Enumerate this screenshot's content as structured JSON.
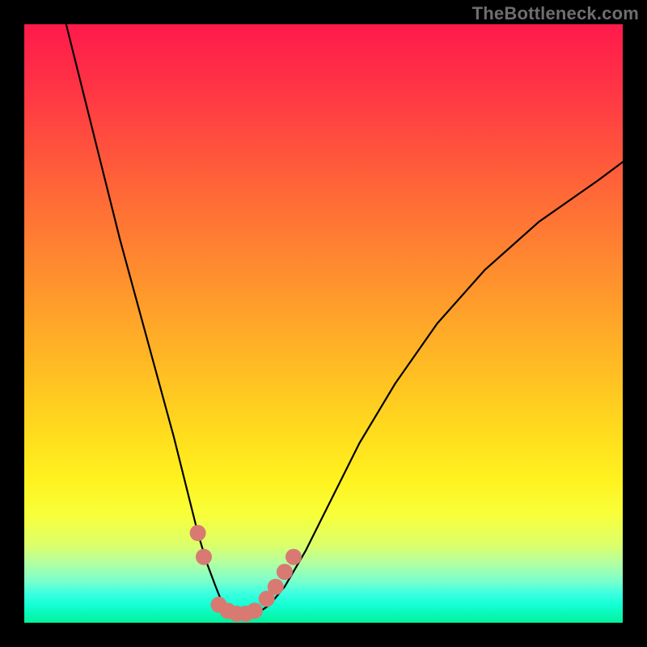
{
  "watermark": "TheBottleneck.com",
  "chart_data": {
    "type": "line",
    "title": "",
    "xlabel": "",
    "ylabel": "",
    "xlim": [
      0,
      100
    ],
    "ylim": [
      0,
      100
    ],
    "grid": false,
    "legend": false,
    "series": [
      {
        "name": "bottleneck-curve",
        "color": "#000000",
        "x": [
          7,
          10,
          13,
          16,
          19,
          22,
          25,
          27,
          29,
          30.5,
          32,
          33,
          34,
          35,
          36,
          37.5,
          39,
          41,
          43.5,
          47,
          51,
          56,
          62,
          69,
          77,
          86,
          96,
          100
        ],
        "y": [
          100,
          88,
          76,
          64,
          53,
          42,
          31,
          23,
          15,
          10,
          6,
          3.5,
          2,
          1.3,
          1,
          1.1,
          1.6,
          3,
          6,
          12,
          20,
          30,
          40,
          50,
          59,
          67,
          74,
          77
        ]
      }
    ],
    "markers": [
      {
        "name": "highlight-point",
        "color": "#d87a72",
        "x": 29.0,
        "y": 15
      },
      {
        "name": "highlight-point",
        "color": "#d87a72",
        "x": 30.0,
        "y": 11
      },
      {
        "name": "highlight-point",
        "color": "#d87a72",
        "x": 32.5,
        "y": 3
      },
      {
        "name": "highlight-point",
        "color": "#d87a72",
        "x": 34.0,
        "y": 2
      },
      {
        "name": "highlight-point",
        "color": "#d87a72",
        "x": 35.5,
        "y": 1.5
      },
      {
        "name": "highlight-point",
        "color": "#d87a72",
        "x": 37.0,
        "y": 1.5
      },
      {
        "name": "highlight-point",
        "color": "#d87a72",
        "x": 38.5,
        "y": 2
      },
      {
        "name": "highlight-point",
        "color": "#d87a72",
        "x": 40.5,
        "y": 4
      },
      {
        "name": "highlight-point",
        "color": "#d87a72",
        "x": 42.0,
        "y": 6
      },
      {
        "name": "highlight-point",
        "color": "#d87a72",
        "x": 43.5,
        "y": 8.5
      },
      {
        "name": "highlight-point",
        "color": "#d87a72",
        "x": 45.0,
        "y": 11
      }
    ]
  }
}
